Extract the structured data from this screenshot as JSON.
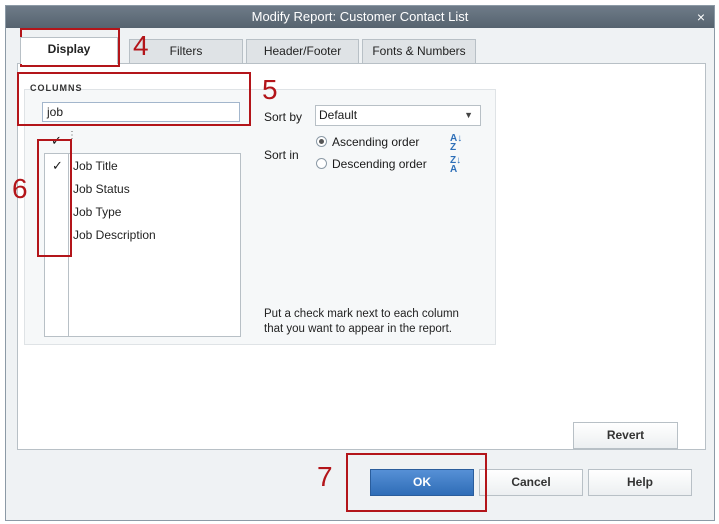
{
  "window": {
    "title": "Modify Report: Customer Contact List",
    "close_glyph": "×"
  },
  "tabs": [
    {
      "label": "Display",
      "active": true
    },
    {
      "label": "Filters"
    },
    {
      "label": "Header/Footer"
    },
    {
      "label": "Fonts & Numbers"
    }
  ],
  "columns": {
    "section_label": "COLUMNS",
    "search_value": "job",
    "header_check": "✓",
    "items": [
      {
        "label": "Job Title",
        "checked": true,
        "check": "✓"
      },
      {
        "label": "Job Status",
        "checked": false
      },
      {
        "label": "Job Type",
        "checked": false
      },
      {
        "label": "Job Description",
        "checked": false
      }
    ]
  },
  "sort": {
    "sort_by_label": "Sort by",
    "sort_by_value": "Default",
    "sort_in_label": "Sort in",
    "ascending_label": "Ascending order",
    "descending_label": "Descending order",
    "selected": "ascending"
  },
  "help_text_line1": "Put a check mark next to each column",
  "help_text_line2": "that you want to appear in the report.",
  "buttons": {
    "revert": "Revert",
    "ok": "OK",
    "cancel": "Cancel",
    "help": "Help"
  },
  "annotations": {
    "n4": "4",
    "n5": "5",
    "n6": "6",
    "n7": "7",
    "color": "#b3151a"
  },
  "icons": {
    "sort_asc": "sort-ascending-icon",
    "sort_desc": "sort-descending-icon",
    "dropdown": "chevron-down-icon"
  }
}
